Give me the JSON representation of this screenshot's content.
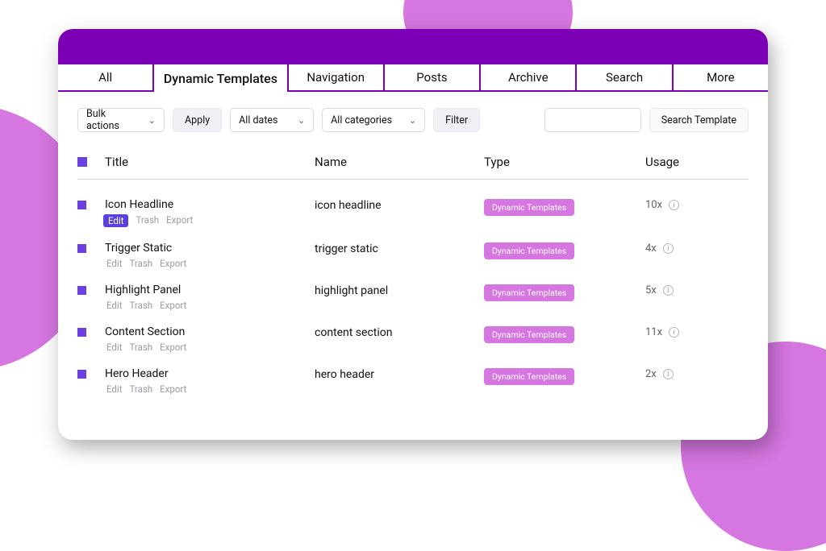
{
  "tabs": [
    {
      "label": "All",
      "active": false
    },
    {
      "label": "Dynamic Templates",
      "active": true
    },
    {
      "label": "Navigation",
      "active": false
    },
    {
      "label": "Posts",
      "active": false
    },
    {
      "label": "Archive",
      "active": false
    },
    {
      "label": "Search",
      "active": false
    },
    {
      "label": "More",
      "active": false
    }
  ],
  "toolbar": {
    "bulk_label": "Bulk actions",
    "apply_label": "Apply",
    "dates_label": "All dates",
    "categories_label": "All categories",
    "filter_label": "Filter",
    "search_value": "",
    "search_button_label": "Search Template"
  },
  "columns": {
    "title": "Title",
    "name": "Name",
    "type": "Type",
    "usage": "Usage"
  },
  "row_actions": {
    "edit": "Edit",
    "trash": "Trash",
    "export": "Export"
  },
  "type_badge_label": "Dynamic Templates",
  "rows": [
    {
      "title": "Icon Headline",
      "name": "icon headline",
      "usage": "10x",
      "edit_highlight": true
    },
    {
      "title": "Trigger Static",
      "name": "trigger static",
      "usage": "4x",
      "edit_highlight": false
    },
    {
      "title": "Highlight Panel",
      "name": "highlight panel",
      "usage": "5x",
      "edit_highlight": false
    },
    {
      "title": "Content Section",
      "name": "content section",
      "usage": "11x",
      "edit_highlight": false
    },
    {
      "title": "Hero Header",
      "name": "hero header",
      "usage": "2x",
      "edit_highlight": false
    }
  ]
}
